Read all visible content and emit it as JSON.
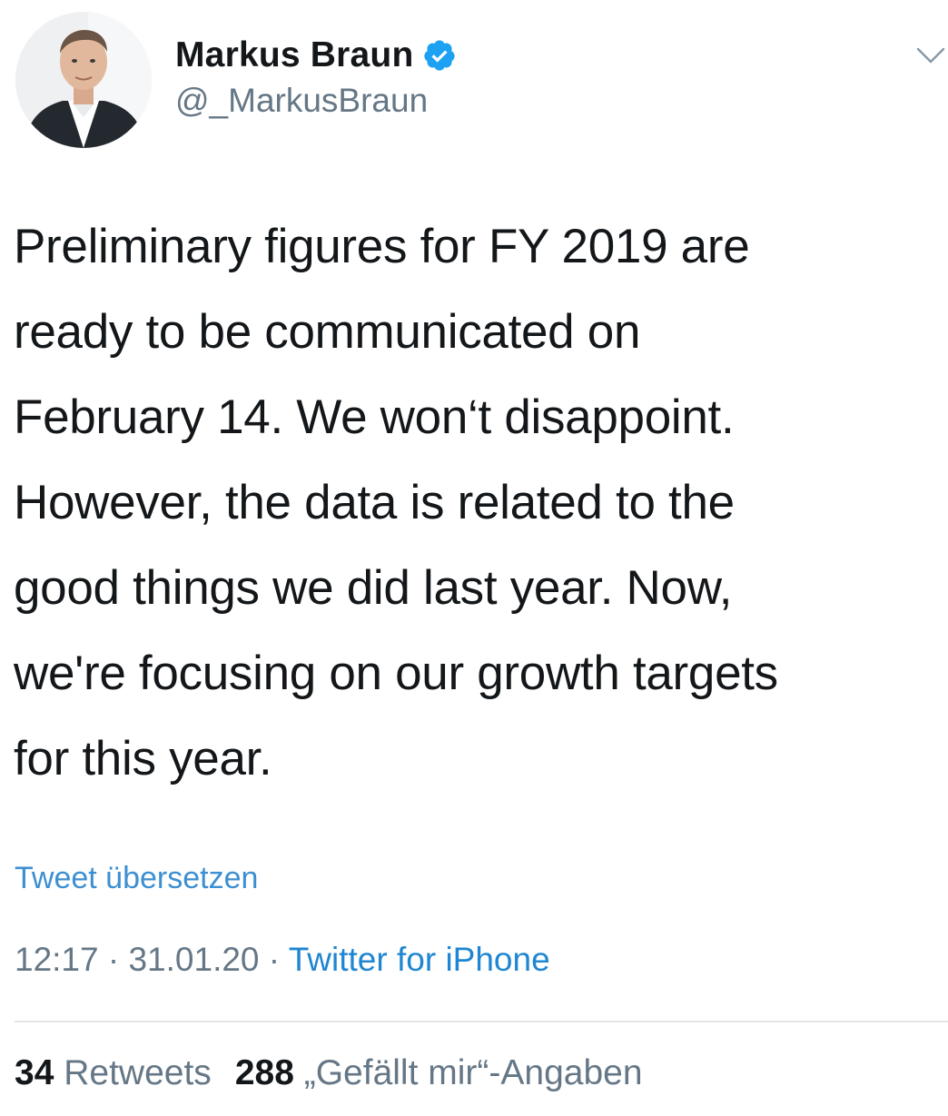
{
  "author": {
    "display_name": "Markus Braun",
    "handle": "@_MarkusBraun",
    "verified": true,
    "verified_icon": "verified-badge-icon",
    "avatar": "profile-photo"
  },
  "tweet": {
    "text": "Preliminary figures for FY 2019 are\nready to be communicated on\nFebruary 14. We won‘t disappoint.\nHowever, the data is related to the\ngood things we did last year. Now,\nwe're focusing on our growth targets\nfor this year.",
    "translate_label": "Tweet übersetzen",
    "time": "12:17",
    "date": "31.01.20",
    "separator": "·",
    "source": "Twitter for iPhone"
  },
  "stats": {
    "retweets_count": "34",
    "retweets_label": "Retweets",
    "likes_count": "288",
    "likes_label": "„Gefällt mir“-Angaben"
  },
  "menu": {
    "icon": "chevron-down-icon"
  },
  "colors": {
    "text": "#14171a",
    "secondary": "#657786",
    "link": "#1f86d1",
    "verified": "#1da1f2",
    "divider": "#e3e6e8"
  }
}
